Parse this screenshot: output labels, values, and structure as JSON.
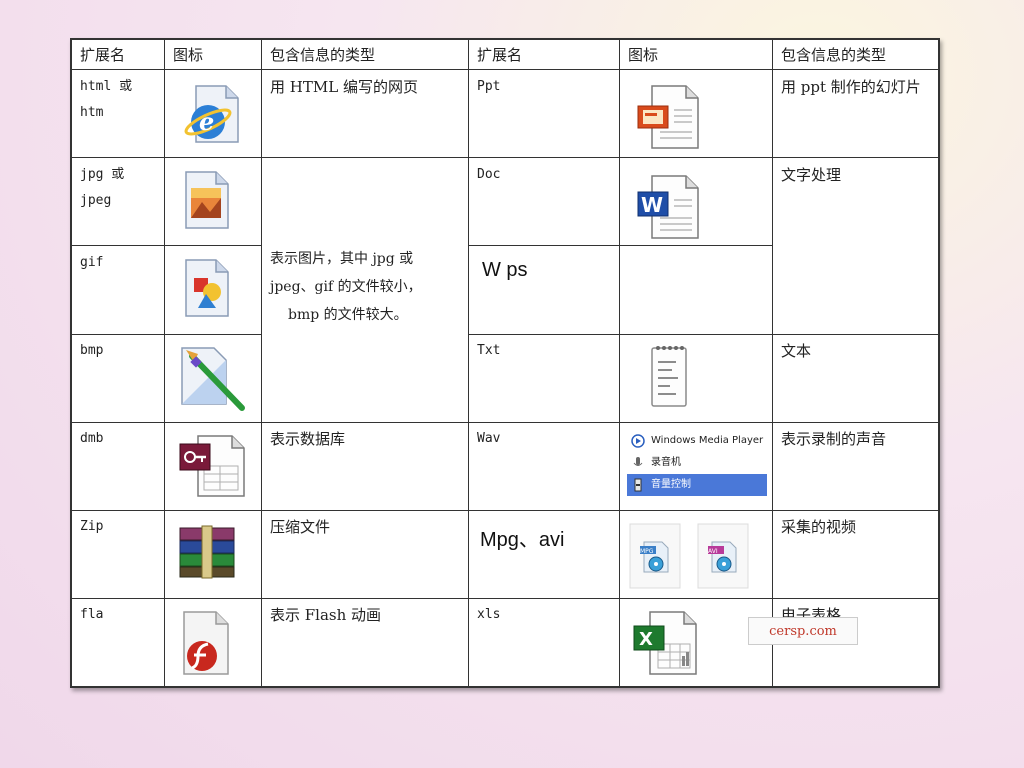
{
  "header": {
    "ext": "扩展名",
    "icon": "图标",
    "info": "包含信息的类型",
    "ext2": "扩展名",
    "icon2": "图标",
    "info2": "包含信息的类型"
  },
  "rows": [
    {
      "ext": "html 或\nhtm",
      "icon": "ie-html-file-icon",
      "info": "用 HTML 编写的网页",
      "ext2": "Ppt",
      "icon2": "powerpoint-file-icon",
      "info2": "用 ppt 制作的幻灯片"
    },
    {
      "ext": "jpg 或\njpeg",
      "icon": "jpeg-image-file-icon",
      "ext2": "Doc",
      "icon2": "word-file-icon",
      "info2": "文字处理"
    },
    {
      "ext": "gif",
      "icon": "gif-image-file-icon",
      "ext2": "W ps",
      "icon2": ""
    },
    {
      "ext": "bmp",
      "icon": "bmp-paint-file-icon",
      "ext2": "Txt",
      "icon2": "notepad-text-file-icon",
      "info2": "文本"
    },
    {
      "ext": "dmb",
      "icon": "access-database-file-icon",
      "info": "表示数据库",
      "ext2": "Wav",
      "icon2": "wmp-menu",
      "info2": "表示录制的声音"
    },
    {
      "ext": "Zip",
      "icon": "winrar-archive-icon",
      "info": "压缩文件",
      "ext2": "Mpg、avi",
      "icon2": "video-file-icons",
      "info2": "采集的视频"
    },
    {
      "ext": "fla",
      "icon": "flash-file-icon",
      "info": "表示 Flash 动画",
      "ext2": "xls",
      "icon2": "excel-file-icon",
      "info2": "电子表格"
    }
  ],
  "image_info": "表示图片，其中 jpg 或 jpeg、gif 的文件较小，bmp 的文件较大。",
  "image_info_lines": [
    "表示图片，其中 jpg 或",
    "jpeg、gif 的文件较小，",
    "bmp 的文件较大。"
  ],
  "wav_menu": [
    "Windows Media Player",
    "录音机",
    "音量控制"
  ],
  "video_labels": [
    "MPG",
    "AVI"
  ],
  "credit": "cersp.com"
}
